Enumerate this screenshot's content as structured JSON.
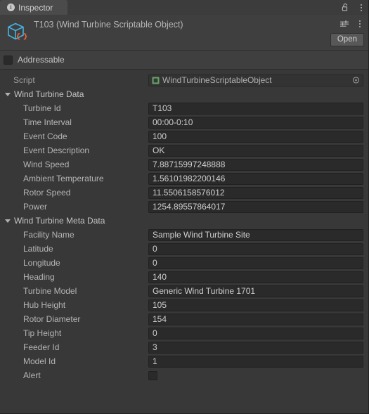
{
  "tab": {
    "label": "Inspector",
    "info_icon": "info-icon",
    "lock_icon": "lock-open-icon",
    "menu_icon": "kebab-menu-icon"
  },
  "object_header": {
    "icon": "scriptable-object-cube-icon",
    "title": "T103 (Wind Turbine Scriptable Object)",
    "preset_icon": "preset-settings-icon",
    "menu_icon": "kebab-menu-icon",
    "open_label": "Open"
  },
  "addressable": {
    "label": "Addressable",
    "checked": false
  },
  "script_row": {
    "label": "Script",
    "value": "WindTurbineScriptableObject",
    "icon": "cs-script-icon",
    "select_icon": "object-picker-icon"
  },
  "sections": [
    {
      "name": "wind-turbine-data",
      "title": "Wind Turbine Data",
      "expanded": true,
      "fields": [
        {
          "label": "Turbine Id",
          "value": "T103",
          "type": "text"
        },
        {
          "label": "Time Interval",
          "value": "00:00-0:10",
          "type": "text"
        },
        {
          "label": "Event Code",
          "value": "100",
          "type": "text"
        },
        {
          "label": "Event Description",
          "value": "OK",
          "type": "text"
        },
        {
          "label": "Wind Speed",
          "value": "7.88715997248888",
          "type": "text"
        },
        {
          "label": "Ambient Temperature",
          "value": "1.56101982200146",
          "type": "text"
        },
        {
          "label": "Rotor Speed",
          "value": "11.5506158576012",
          "type": "text"
        },
        {
          "label": "Power",
          "value": "1254.89557864017",
          "type": "text"
        }
      ]
    },
    {
      "name": "wind-turbine-meta-data",
      "title": "Wind Turbine Meta Data",
      "expanded": true,
      "fields": [
        {
          "label": "Facility Name",
          "value": "Sample Wind Turbine Site",
          "type": "text"
        },
        {
          "label": "Latitude",
          "value": "0",
          "type": "text"
        },
        {
          "label": "Longitude",
          "value": "0",
          "type": "text"
        },
        {
          "label": "Heading",
          "value": "140",
          "type": "text"
        },
        {
          "label": "Turbine Model",
          "value": "Generic Wind Turbine 1701",
          "type": "text"
        },
        {
          "label": "Hub Height",
          "value": "105",
          "type": "text"
        },
        {
          "label": "Rotor Diameter",
          "value": "154",
          "type": "text"
        },
        {
          "label": "Tip Height",
          "value": "0",
          "type": "text"
        },
        {
          "label": "Feeder Id",
          "value": "3",
          "type": "text"
        },
        {
          "label": "Model Id",
          "value": "1",
          "type": "text"
        },
        {
          "label": "Alert",
          "value": "",
          "type": "checkbox",
          "checked": false
        }
      ]
    }
  ],
  "colors": {
    "background": "#383838",
    "panel": "#3f3f3f",
    "tab_active": "#4b4b4b",
    "field": "#2a2a2a",
    "accent_cube": "#45b3e0",
    "accent_braces": "#e8603c",
    "script_icon": "#6c9e6c",
    "text": "#b4b4b4"
  }
}
